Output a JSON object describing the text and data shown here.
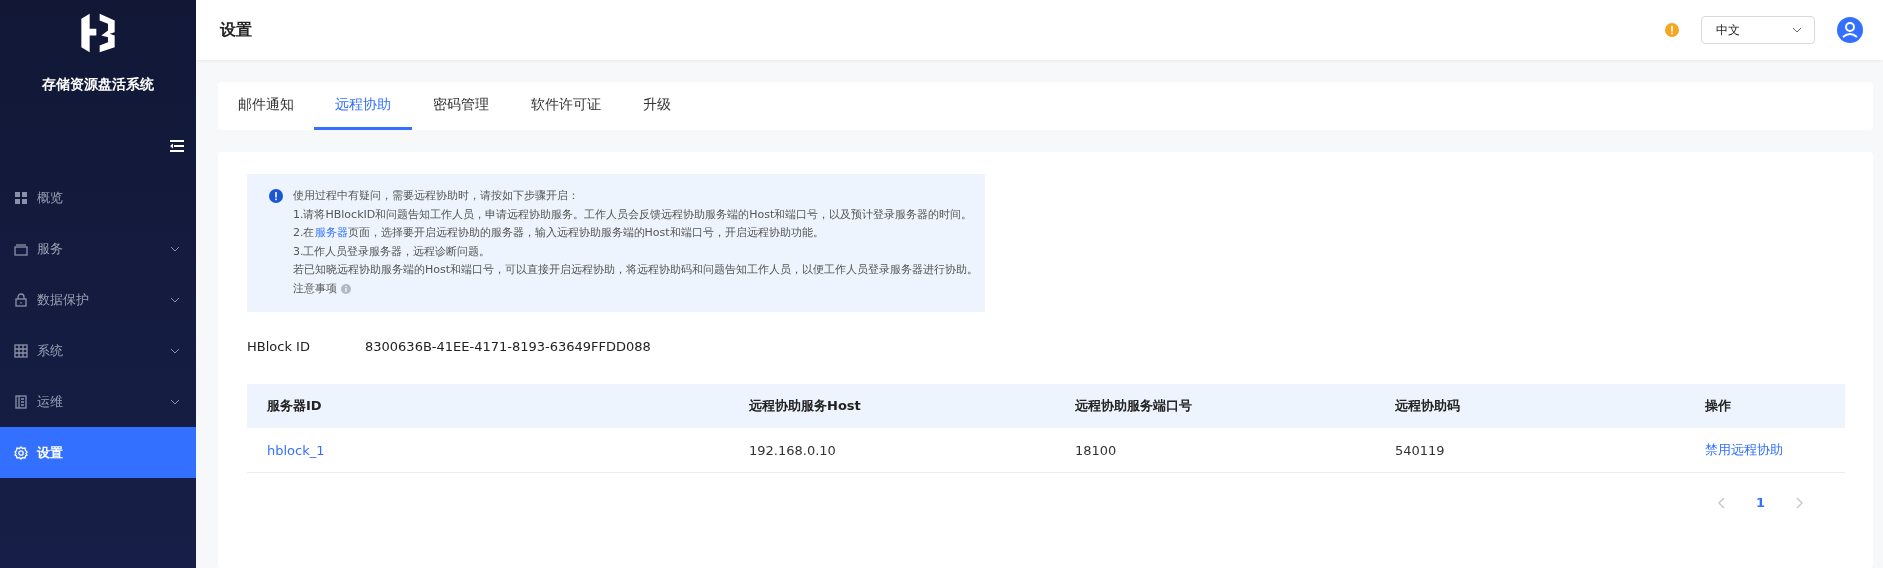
{
  "sidebar": {
    "app_name": "存储资源盘活系统",
    "items": [
      {
        "label": "概览",
        "selected": false,
        "expandable": false
      },
      {
        "label": "服务",
        "selected": false,
        "expandable": true
      },
      {
        "label": "数据保护",
        "selected": false,
        "expandable": true
      },
      {
        "label": "系统",
        "selected": false,
        "expandable": true
      },
      {
        "label": "运维",
        "selected": false,
        "expandable": true
      },
      {
        "label": "设置",
        "selected": true,
        "expandable": false
      }
    ]
  },
  "header": {
    "title": "设置",
    "language": {
      "value": "中文"
    }
  },
  "tabs": [
    {
      "label": "邮件通知",
      "selected": false
    },
    {
      "label": "远程协助",
      "selected": true
    },
    {
      "label": "密码管理",
      "selected": false
    },
    {
      "label": "软件许可证",
      "selected": false
    },
    {
      "label": "升级",
      "selected": false
    }
  ],
  "notice": {
    "lines": [
      {
        "text": "使用过程中有疑问，需要远程协助时，请按如下步骤开启："
      },
      {
        "text": "1.请将HBlockID和问题告知工作人员，申请远程协助服务。工作人员会反馈远程协助服务端的Host和端口号，以及预计登录服务器的时间。"
      },
      {
        "text": "2.在",
        "link": "服务器",
        "text_after": "页面，选择要开启远程协助的服务器，输入远程协助服务端的Host和端口号，开启远程协助功能。"
      },
      {
        "text": "3.工作人员登录服务器，远程诊断问题。"
      },
      {
        "text": "若已知晓远程协助服务端的Host和端口号，可以直接开启远程协助，将远程协助码和问题告知工作人员，以便工作人员登录服务器进行协助。"
      }
    ],
    "footnote": "注意事项"
  },
  "hblock_id": {
    "label": "HBlock ID",
    "value": "8300636B-41EE-4171-8193-63649FFDD088"
  },
  "table": {
    "columns": [
      "服务器ID",
      "远程协助服务Host",
      "远程协助服务端口号",
      "远程协助码",
      "操作"
    ],
    "rows": [
      {
        "cells": [
          "hblock_1",
          "192.168.0.10",
          "18100",
          "540119",
          "禁用远程协助"
        ]
      }
    ]
  },
  "pagination": {
    "prev_disabled": true,
    "next_disabled": true,
    "pages": [
      {
        "label": "1",
        "selected": true
      }
    ]
  }
}
